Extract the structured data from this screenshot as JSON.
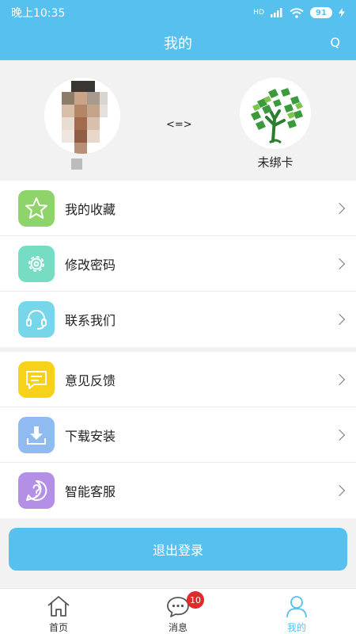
{
  "status_bar": {
    "time": "晚上10:35",
    "network": "HD",
    "battery": "91"
  },
  "header": {
    "title": "我的",
    "action": "Q"
  },
  "profile": {
    "link_symbol": "<=>",
    "card_status": "未绑卡"
  },
  "menu": {
    "group1": [
      {
        "label": "我的收藏",
        "icon": "star-icon",
        "color": "#8fd36b"
      },
      {
        "label": "修改密码",
        "icon": "gear-icon",
        "color": "#76dcc4"
      },
      {
        "label": "联系我们",
        "icon": "headset-icon",
        "color": "#77d6ea"
      }
    ],
    "group2": [
      {
        "label": "意见反馈",
        "icon": "feedback-icon",
        "color": "#f8d11a"
      },
      {
        "label": "下载安装",
        "icon": "download-icon",
        "color": "#8fbbf0"
      },
      {
        "label": "智能客服",
        "icon": "question-icon",
        "color": "#b38fe6"
      }
    ]
  },
  "logout_label": "退出登录",
  "tabbar": {
    "tabs": [
      {
        "label": "首页",
        "icon": "home-icon"
      },
      {
        "label": "消息",
        "icon": "message-icon",
        "badge": "10"
      },
      {
        "label": "我的",
        "icon": "user-icon",
        "active": true
      }
    ]
  },
  "colors": {
    "accent": "#56c1ef",
    "badge": "#e02b2b"
  }
}
